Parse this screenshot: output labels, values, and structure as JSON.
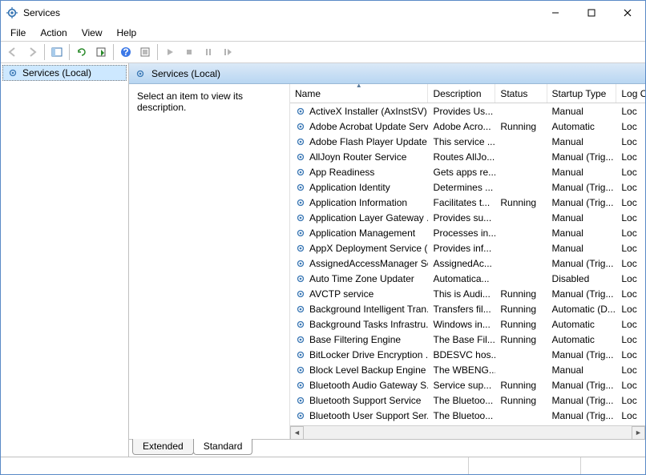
{
  "window": {
    "title": "Services"
  },
  "menubar": [
    "File",
    "Action",
    "View",
    "Help"
  ],
  "tree": {
    "root_label": "Services (Local)"
  },
  "right": {
    "header_label": "Services (Local)",
    "desc_prompt": "Select an item to view its description."
  },
  "columns": {
    "name": "Name",
    "description": "Description",
    "status": "Status",
    "startup": "Startup Type",
    "logon": "Log On As"
  },
  "col_widths": {
    "name": 175,
    "description": 85,
    "status": 65,
    "startup": 88,
    "logon": 36
  },
  "services": [
    {
      "name": "ActiveX Installer (AxInstSV)",
      "description": "Provides Us...",
      "status": "",
      "startup": "Manual",
      "logon": "Loc"
    },
    {
      "name": "Adobe Acrobat Update Serv",
      "description": "Adobe Acro...",
      "status": "Running",
      "startup": "Automatic",
      "logon": "Loc"
    },
    {
      "name": "Adobe Flash Player Update ...",
      "description": "This service ...",
      "status": "",
      "startup": "Manual",
      "logon": "Loc"
    },
    {
      "name": "AllJoyn Router Service",
      "description": "Routes AllJo...",
      "status": "",
      "startup": "Manual (Trig...",
      "logon": "Loc"
    },
    {
      "name": "App Readiness",
      "description": "Gets apps re...",
      "status": "",
      "startup": "Manual",
      "logon": "Loc"
    },
    {
      "name": "Application Identity",
      "description": "Determines ...",
      "status": "",
      "startup": "Manual (Trig...",
      "logon": "Loc"
    },
    {
      "name": "Application Information",
      "description": "Facilitates t...",
      "status": "Running",
      "startup": "Manual (Trig...",
      "logon": "Loc"
    },
    {
      "name": "Application Layer Gateway ...",
      "description": "Provides su...",
      "status": "",
      "startup": "Manual",
      "logon": "Loc"
    },
    {
      "name": "Application Management",
      "description": "Processes in...",
      "status": "",
      "startup": "Manual",
      "logon": "Loc"
    },
    {
      "name": "AppX Deployment Service (...",
      "description": "Provides inf...",
      "status": "",
      "startup": "Manual",
      "logon": "Loc"
    },
    {
      "name": "AssignedAccessManager Se...",
      "description": "AssignedAc...",
      "status": "",
      "startup": "Manual (Trig...",
      "logon": "Loc"
    },
    {
      "name": "Auto Time Zone Updater",
      "description": "Automatica...",
      "status": "",
      "startup": "Disabled",
      "logon": "Loc"
    },
    {
      "name": "AVCTP service",
      "description": "This is Audi...",
      "status": "Running",
      "startup": "Manual (Trig...",
      "logon": "Loc"
    },
    {
      "name": "Background Intelligent Tran...",
      "description": "Transfers fil...",
      "status": "Running",
      "startup": "Automatic (D...",
      "logon": "Loc"
    },
    {
      "name": "Background Tasks Infrastru...",
      "description": "Windows in...",
      "status": "Running",
      "startup": "Automatic",
      "logon": "Loc"
    },
    {
      "name": "Base Filtering Engine",
      "description": "The Base Fil...",
      "status": "Running",
      "startup": "Automatic",
      "logon": "Loc"
    },
    {
      "name": "BitLocker Drive Encryption ...",
      "description": "BDESVC hos...",
      "status": "",
      "startup": "Manual (Trig...",
      "logon": "Loc"
    },
    {
      "name": "Block Level Backup Engine ...",
      "description": "The WBENG...",
      "status": "",
      "startup": "Manual",
      "logon": "Loc"
    },
    {
      "name": "Bluetooth Audio Gateway S...",
      "description": "Service sup...",
      "status": "Running",
      "startup": "Manual (Trig...",
      "logon": "Loc"
    },
    {
      "name": "Bluetooth Support Service",
      "description": "The Bluetoo...",
      "status": "Running",
      "startup": "Manual (Trig...",
      "logon": "Loc"
    },
    {
      "name": "Bluetooth User Support Ser...",
      "description": "The Bluetoo...",
      "status": "",
      "startup": "Manual (Trig...",
      "logon": "Loc"
    }
  ],
  "tabs": {
    "extended": "Extended",
    "standard": "Standard"
  }
}
